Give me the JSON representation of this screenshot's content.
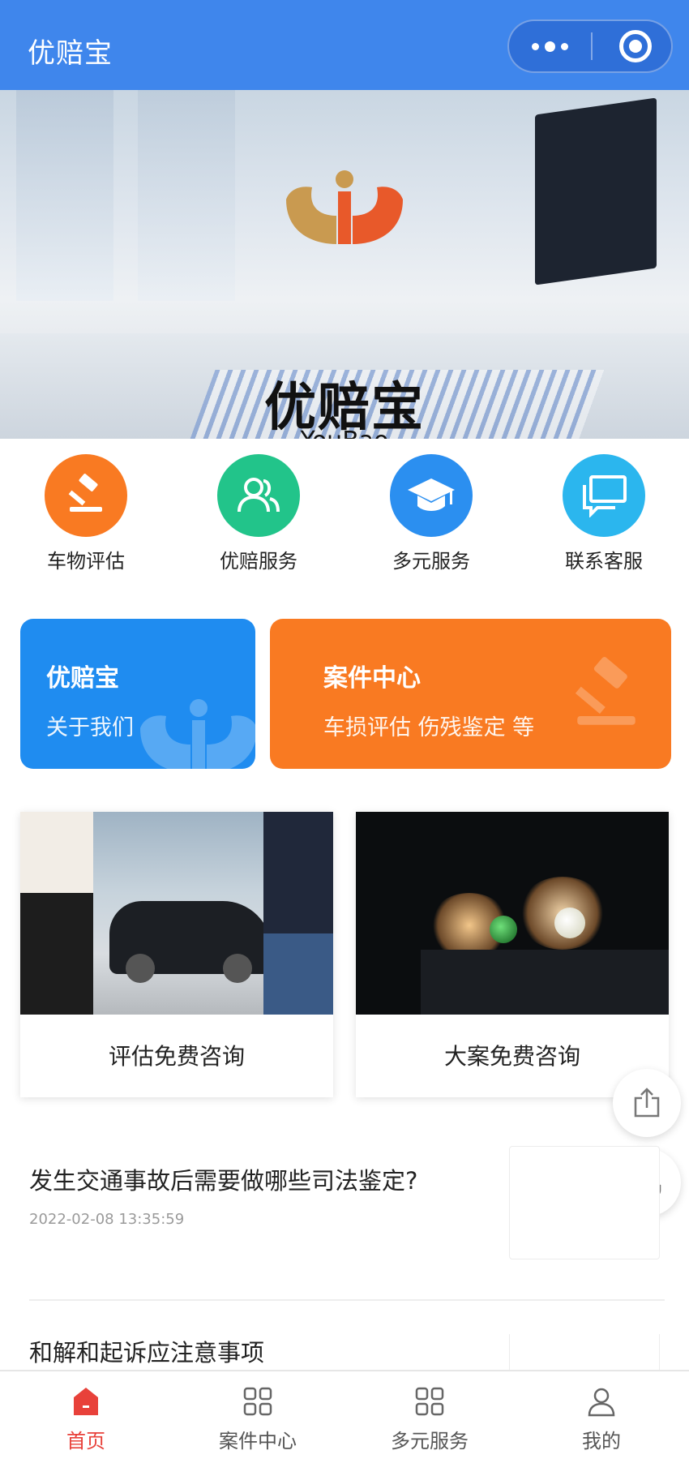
{
  "app": {
    "title": "优赔宝"
  },
  "banner": {
    "logo_cn": "优赔宝",
    "logo_en": "YouBao",
    "slide_count": 3,
    "active_slide": 1
  },
  "quick_nav": [
    {
      "label": "车物评估",
      "icon": "gavel-icon",
      "color": "#f97a22"
    },
    {
      "label": "优赔服务",
      "icon": "users-icon",
      "color": "#22c48a"
    },
    {
      "label": "多元服务",
      "icon": "graduation-cap-icon",
      "color": "#2b8ff0"
    },
    {
      "label": "联系客服",
      "icon": "chat-icon",
      "color": "#2bb6ee"
    }
  ],
  "cards": {
    "about": {
      "title": "优赔宝",
      "subtitle": "关于我们",
      "color": "#1f8cf0"
    },
    "cases": {
      "title": "案件中心",
      "subtitle": "车损评估 伤残鉴定 等",
      "color": "#f97a22"
    }
  },
  "tiles": [
    {
      "caption": "评估免费咨询"
    },
    {
      "caption": "大案免费咨询"
    }
  ],
  "articles": [
    {
      "title": "发生交通事故后需要做哪些司法鉴定?",
      "date": "2022-02-08 13:35:59"
    },
    {
      "title": "和解和起诉应注意事项",
      "date": ""
    }
  ],
  "tabbar": [
    {
      "label": "首页",
      "icon": "home-icon",
      "active": true
    },
    {
      "label": "案件中心",
      "icon": "grid-icon",
      "active": false
    },
    {
      "label": "多元服务",
      "icon": "grid-icon",
      "active": false
    },
    {
      "label": "我的",
      "icon": "user-icon",
      "active": false
    }
  ],
  "colors": {
    "header": "#3f86ec",
    "accent_red": "#e8413a"
  }
}
